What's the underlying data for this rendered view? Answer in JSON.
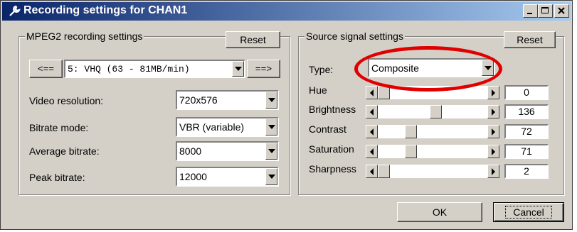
{
  "window": {
    "title": "Recording settings for CHAN1"
  },
  "mpeg2": {
    "group_label": "MPEG2 recording settings",
    "reset_label": "Reset",
    "prev_label": "<==",
    "next_label": "==>",
    "preset_value": "5: VHQ (63 - 81MB/min)",
    "fields": [
      {
        "label": "Video resolution:",
        "value": "720x576"
      },
      {
        "label": "Bitrate mode:",
        "value": "VBR (variable)"
      },
      {
        "label": "Average bitrate:",
        "value": "8000"
      },
      {
        "label": "Peak bitrate:",
        "value": "12000"
      }
    ]
  },
  "source": {
    "group_label": "Source signal settings",
    "reset_label": "Reset",
    "type_label": "Type:",
    "type_value": "Composite",
    "sliders": [
      {
        "label": "Hue",
        "value": "0",
        "position": 0.0
      },
      {
        "label": "Brightness",
        "value": "136",
        "position": 0.53
      },
      {
        "label": "Contrast",
        "value": "72",
        "position": 0.28
      },
      {
        "label": "Saturation",
        "value": "71",
        "position": 0.28
      },
      {
        "label": "Sharpness",
        "value": "2",
        "position": 0.0
      }
    ]
  },
  "footer": {
    "ok_label": "OK",
    "cancel_label": "Cancel"
  },
  "colors": {
    "highlight_circle": "#e00000",
    "title_start": "#0a246a",
    "title_end": "#a6caf0"
  },
  "icons": {
    "title": "wrench-icon"
  }
}
